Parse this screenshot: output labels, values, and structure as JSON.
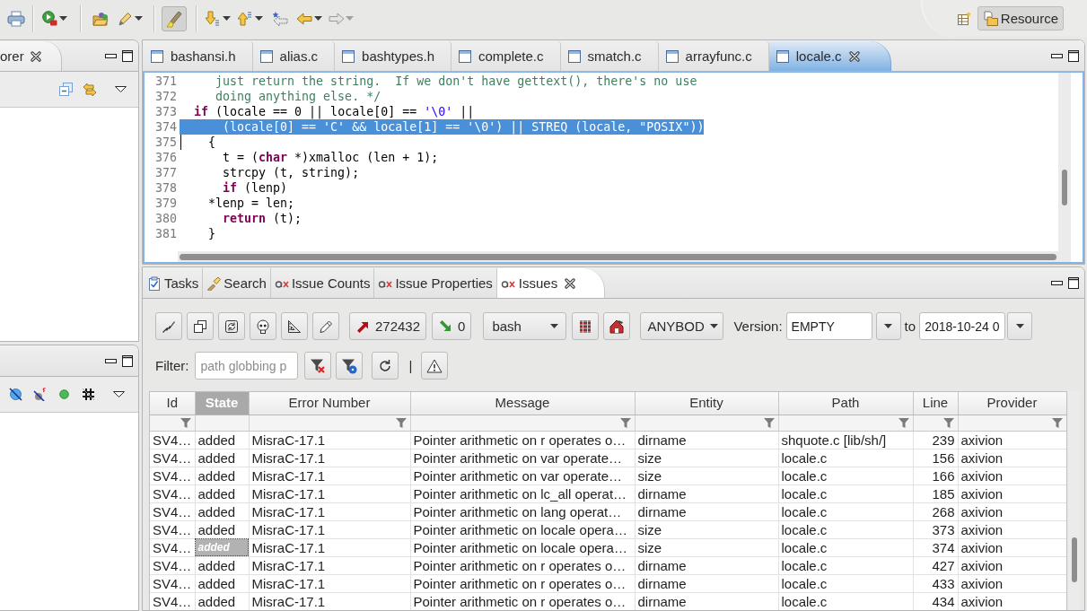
{
  "main_toolbar": {
    "toggle": {
      "pressed": true
    },
    "forward": {
      "disabled": true
    }
  },
  "perspectives": [
    {
      "label": "Resource",
      "selected": true
    }
  ],
  "explorer_view": {
    "tab_label": "orer"
  },
  "editor": {
    "tabs": [
      {
        "label": "bashansi.h",
        "selected": false
      },
      {
        "label": "alias.c",
        "selected": false
      },
      {
        "label": "bashtypes.h",
        "selected": false
      },
      {
        "label": "complete.c",
        "selected": false
      },
      {
        "label": "smatch.c",
        "selected": false
      },
      {
        "label": "arrayfunc.c",
        "selected": false
      },
      {
        "label": "locale.c",
        "selected": true
      }
    ],
    "lines": [
      {
        "number": "371",
        "selected": false,
        "caret": false,
        "tokens": [
          {
            "kind": "comment",
            "text": "     just return the string.  If we don't have gettext(), there's no use"
          }
        ]
      },
      {
        "number": "372",
        "selected": false,
        "caret": false,
        "tokens": [
          {
            "kind": "comment",
            "text": "     doing anything else. */"
          }
        ]
      },
      {
        "number": "373",
        "selected": false,
        "caret": false,
        "tokens": [
          {
            "kind": "keyword",
            "text": "  if"
          },
          {
            "kind": "plain",
            "text": " (locale == 0 || locale[0] == "
          },
          {
            "kind": "string",
            "text": "'\\0'"
          },
          {
            "kind": "plain",
            "text": " ||"
          }
        ]
      },
      {
        "number": "374",
        "selected": true,
        "caret": false,
        "tokens": [
          {
            "kind": "plain",
            "text": "      (locale[0] == 'C' && locale[1] == '\\0') || STREQ (locale, \"POSIX\"))"
          }
        ]
      },
      {
        "number": "375",
        "selected": false,
        "caret": true,
        "tokens": [
          {
            "kind": "plain",
            "text": "    {"
          }
        ]
      },
      {
        "number": "376",
        "selected": false,
        "caret": false,
        "tokens": [
          {
            "kind": "plain",
            "text": "      t = ("
          },
          {
            "kind": "keyword",
            "text": "char"
          },
          {
            "kind": "plain",
            "text": " *)xmalloc (len + 1);"
          }
        ]
      },
      {
        "number": "377",
        "selected": false,
        "caret": false,
        "tokens": [
          {
            "kind": "plain",
            "text": "      strcpy (t, string);"
          }
        ]
      },
      {
        "number": "378",
        "selected": false,
        "caret": false,
        "tokens": [
          {
            "kind": "keyword",
            "text": "      if"
          },
          {
            "kind": "plain",
            "text": " (lenp)"
          }
        ]
      },
      {
        "number": "379",
        "selected": false,
        "caret": false,
        "tokens": [
          {
            "kind": "plain",
            "text": "    *lenp = len;"
          }
        ]
      },
      {
        "number": "380",
        "selected": false,
        "caret": false,
        "tokens": [
          {
            "kind": "keyword",
            "text": "      return"
          },
          {
            "kind": "plain",
            "text": " (t);"
          }
        ]
      },
      {
        "number": "381",
        "selected": false,
        "caret": false,
        "tokens": [
          {
            "kind": "plain",
            "text": "    }"
          }
        ]
      }
    ]
  },
  "issues_view": {
    "tabs": [
      {
        "kind": "tasks",
        "label": "Tasks",
        "selected": false
      },
      {
        "kind": "search",
        "label": "Search",
        "selected": false
      },
      {
        "kind": "issues",
        "label": "Issue Counts",
        "selected": false
      },
      {
        "kind": "issues",
        "label": "Issue Properties",
        "selected": false
      },
      {
        "kind": "issues",
        "label": "Issues",
        "selected": true
      }
    ],
    "toolbar": {
      "added_count": "272432",
      "removed_count": "0",
      "project": "bash",
      "user": "ANYBOD",
      "version_label": "Version:",
      "version_from": "EMPTY",
      "to_label": "to",
      "version_to": "2018-10-24 0"
    },
    "filter": {
      "label": "Filter:",
      "placeholder": "path globbing p",
      "divider": "|"
    },
    "table": {
      "columns": [
        {
          "label": "Id",
          "kind": "text",
          "sorted": false,
          "filterable": true
        },
        {
          "label": "State",
          "kind": "text",
          "sorted": true,
          "filterable": false
        },
        {
          "label": "Error Number",
          "kind": "text",
          "sorted": false,
          "filterable": true
        },
        {
          "label": "Message",
          "kind": "text",
          "sorted": false,
          "filterable": true
        },
        {
          "label": "Entity",
          "kind": "text",
          "sorted": false,
          "filterable": true
        },
        {
          "label": "Path",
          "kind": "text",
          "sorted": false,
          "filterable": true
        },
        {
          "label": "Line",
          "kind": "number",
          "sorted": false,
          "filterable": true
        },
        {
          "label": "Provider",
          "kind": "text",
          "sorted": false,
          "filterable": true
        }
      ],
      "rows": [
        {
          "focused": false,
          "cells": [
            "SV4…",
            "added",
            "MisraC-17.1",
            "Pointer arithmetic on r operates o…",
            "dirname",
            "shquote.c [lib/sh/]",
            "239",
            "axivion"
          ]
        },
        {
          "focused": false,
          "cells": [
            "SV4…",
            "added",
            "MisraC-17.1",
            "Pointer arithmetic on var operate…",
            "size",
            "locale.c",
            "156",
            "axivion"
          ]
        },
        {
          "focused": false,
          "cells": [
            "SV4…",
            "added",
            "MisraC-17.1",
            "Pointer arithmetic on var operate…",
            "size",
            "locale.c",
            "166",
            "axivion"
          ]
        },
        {
          "focused": false,
          "cells": [
            "SV4…",
            "added",
            "MisraC-17.1",
            "Pointer arithmetic on lc_all operat…",
            "dirname",
            "locale.c",
            "185",
            "axivion"
          ]
        },
        {
          "focused": false,
          "cells": [
            "SV4…",
            "added",
            "MisraC-17.1",
            "Pointer arithmetic on lang operat…",
            "dirname",
            "locale.c",
            "268",
            "axivion"
          ]
        },
        {
          "focused": false,
          "cells": [
            "SV4…",
            "added",
            "MisraC-17.1",
            "Pointer arithmetic on locale opera…",
            "size",
            "locale.c",
            "373",
            "axivion"
          ]
        },
        {
          "focused": true,
          "cells": [
            "SV4…",
            "added",
            "MisraC-17.1",
            "Pointer arithmetic on locale opera…",
            "size",
            "locale.c",
            "374",
            "axivion"
          ]
        },
        {
          "focused": false,
          "cells": [
            "SV4…",
            "added",
            "MisraC-17.1",
            "Pointer arithmetic on r operates o…",
            "dirname",
            "locale.c",
            "427",
            "axivion"
          ]
        },
        {
          "focused": false,
          "cells": [
            "SV4…",
            "added",
            "MisraC-17.1",
            "Pointer arithmetic on r operates o…",
            "dirname",
            "locale.c",
            "433",
            "axivion"
          ]
        },
        {
          "focused": false,
          "cells": [
            "SV4…",
            "added",
            "MisraC-17.1",
            "Pointer arithmetic on r operates o…",
            "dirname",
            "locale.c",
            "434",
            "axivion"
          ]
        }
      ]
    }
  }
}
